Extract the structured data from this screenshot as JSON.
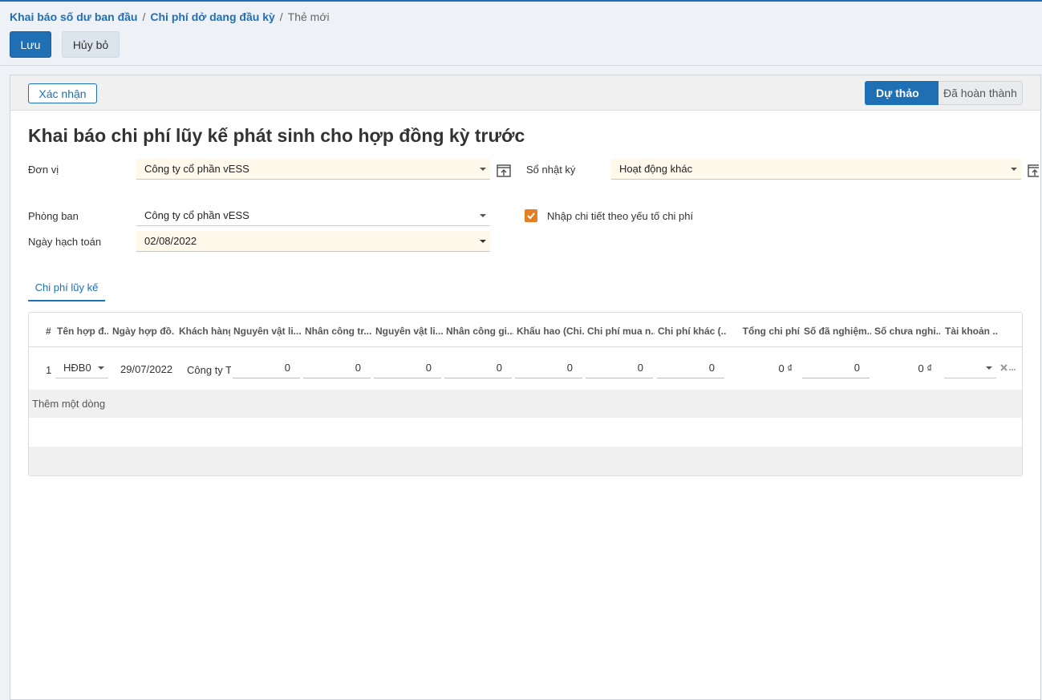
{
  "breadcrumb": {
    "item1": "Khai báo số dư ban đầu",
    "item2": "Chi phí dở dang đầu kỳ",
    "current": "Thẻ mới",
    "separator": "/"
  },
  "actions": {
    "save": "Lưu",
    "discard": "Hủy bỏ"
  },
  "statusbar": {
    "confirm": "Xác nhận",
    "steps": [
      "Dự thảo",
      "Đã hoàn thành"
    ]
  },
  "form": {
    "title": "Khai báo chi phí lũy kế phát sinh cho hợp đồng kỳ trước",
    "don_vi": {
      "label": "Đơn vị",
      "value": "Công ty cổ phần vESS"
    },
    "so_nhat_ky": {
      "label": "Sổ nhật ký",
      "value": "Hoạt động khác"
    },
    "phong_ban": {
      "label": "Phòng ban",
      "value": "Công ty cổ phần vESS"
    },
    "nhap_chi_tiet": {
      "label": "Nhập chi tiết theo yếu tố chi phí",
      "checked": true
    },
    "ngay_hach_toan": {
      "label": "Ngày hạch toán",
      "value": "02/08/2022"
    }
  },
  "tabs": [
    "Chi phí lũy kế"
  ],
  "table": {
    "headers": [
      "#",
      "Tên hợp đ...",
      "Ngày hợp đồ...",
      "Khách hàng",
      "Nguyên vật li...",
      "Nhân công tr...",
      "Nguyên vật li...",
      "Nhân công gi...",
      "Khấu hao (Chi...",
      "Chi phí mua n...",
      "Chi phí khác (...",
      "Tổng chi phí",
      "Số đã nghiệm...",
      "Số chưa nghi...",
      "Tài khoản ..."
    ],
    "rows": [
      {
        "index": "1",
        "contract": "HĐB0",
        "date": "29/07/2022",
        "customer": "Công ty Th",
        "nvl_tt": "0",
        "nc_tt": "0",
        "nvl_gt": "0",
        "nc_gt": "0",
        "khau_hao": "0",
        "mua_ngoai": "0",
        "khac": "0",
        "tong": "0 ₫",
        "da_nt": "0",
        "chua_nt": "0 ₫"
      }
    ],
    "add_line": "Thêm một dòng"
  },
  "colors": {
    "primary": "#1f6fb5",
    "required_bg": "#fff9ec",
    "checkbox": "#e67e22"
  },
  "icons": {
    "external_link": "external-link-icon",
    "delete": "delete-row-icon",
    "dropdown": "caret-down-icon"
  }
}
